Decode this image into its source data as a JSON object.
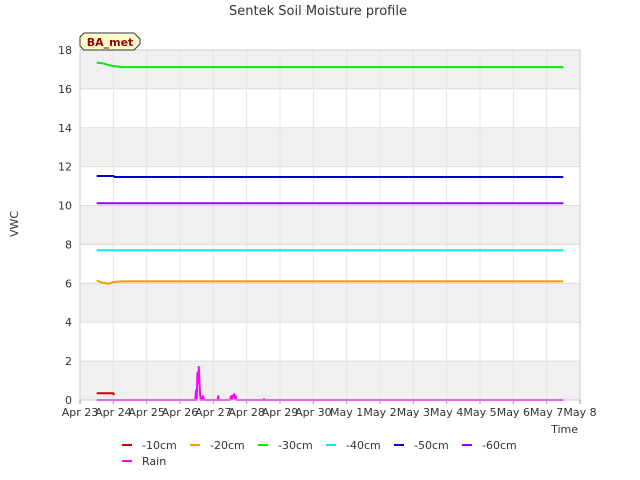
{
  "chart_data": {
    "type": "line",
    "title": "Sentek Soil Moisture profile",
    "badge": "BA_met",
    "xlabel": "Time",
    "ylabel": "VWC",
    "ylim": [
      0,
      18
    ],
    "yticks": [
      0,
      2,
      4,
      6,
      8,
      10,
      12,
      14,
      16,
      18
    ],
    "xlim": [
      "2023-04-23",
      "2023-05-08"
    ],
    "xtick_labels": [
      "Apr 23",
      "Apr 24",
      "Apr 25",
      "Apr 26",
      "Apr 27",
      "Apr 28",
      "Apr 29",
      "Apr 30",
      "May 1",
      "May 2",
      "May 3",
      "May 4",
      "May 5",
      "May 6",
      "May 7",
      "May 8"
    ],
    "grid": true,
    "legend_position": "bottom",
    "series": [
      {
        "name": "-10cm",
        "color": "#cc0000",
        "x": [
          "2023-04-23 12:00",
          "2023-04-24 00:00",
          "2023-04-24 00:30"
        ],
        "y": [
          0.35,
          0.35,
          0.25
        ]
      },
      {
        "name": "-20cm",
        "color": "#ff9900",
        "x": [
          "2023-04-23 12:00",
          "2023-04-23 15:00",
          "2023-04-23 21:00",
          "2023-04-24 00:00",
          "2023-04-24 06:00",
          "2023-05-07 12:00"
        ],
        "y": [
          6.15,
          6.05,
          5.98,
          6.07,
          6.1,
          6.1
        ]
      },
      {
        "name": "-30cm",
        "color": "#00ee00",
        "x": [
          "2023-04-23 12:00",
          "2023-04-23 16:00",
          "2023-04-23 22:00",
          "2023-04-24 06:00",
          "2023-05-07 12:00"
        ],
        "y": [
          17.35,
          17.32,
          17.2,
          17.12,
          17.12
        ]
      },
      {
        "name": "-40cm",
        "color": "#00eeee",
        "x": [
          "2023-04-23 12:00",
          "2023-05-07 12:00"
        ],
        "y": [
          7.7,
          7.7
        ]
      },
      {
        "name": "-50cm",
        "color": "#0000cc",
        "x": [
          "2023-04-23 12:00",
          "2023-04-24 00:00",
          "2023-04-24 01:00",
          "2023-05-07 12:00"
        ],
        "y": [
          11.52,
          11.52,
          11.47,
          11.47
        ]
      },
      {
        "name": "-60cm",
        "color": "#9900ee",
        "x": [
          "2023-04-23 12:00",
          "2023-05-07 12:00"
        ],
        "y": [
          10.12,
          10.12
        ]
      },
      {
        "name": "Rain",
        "color": "#ff00ff",
        "x": [
          "2023-04-23 12:00",
          "2023-04-26 11:00",
          "2023-04-26 11:30",
          "2023-04-26 12:00",
          "2023-04-26 12:30",
          "2023-04-26 13:00",
          "2023-04-26 13:30",
          "2023-04-26 14:00",
          "2023-04-26 14:30",
          "2023-04-26 15:00",
          "2023-04-26 16:00",
          "2023-04-26 16:30",
          "2023-04-26 17:00",
          "2023-04-26 17:30",
          "2023-04-27 03:00",
          "2023-04-27 03:30",
          "2023-04-27 04:00",
          "2023-04-27 12:00",
          "2023-04-27 12:30",
          "2023-04-27 13:00",
          "2023-04-27 13:30",
          "2023-04-27 14:00",
          "2023-04-27 14:30",
          "2023-04-27 15:00",
          "2023-04-27 15:30",
          "2023-04-27 16:00",
          "2023-04-27 16:30",
          "2023-04-27 17:00",
          "2023-04-28 12:00",
          "2023-04-28 12:30",
          "2023-04-28 13:00",
          "2023-05-07 12:00"
        ],
        "y": [
          0,
          0,
          0.5,
          0,
          1.4,
          0.9,
          1.7,
          1.0,
          0.3,
          0,
          0,
          0.2,
          0.1,
          0,
          0,
          0.2,
          0,
          0,
          0.15,
          0.2,
          0.05,
          0.2,
          0.25,
          0.3,
          0.1,
          0.2,
          0.05,
          0,
          0,
          0.05,
          0,
          0
        ]
      }
    ]
  }
}
